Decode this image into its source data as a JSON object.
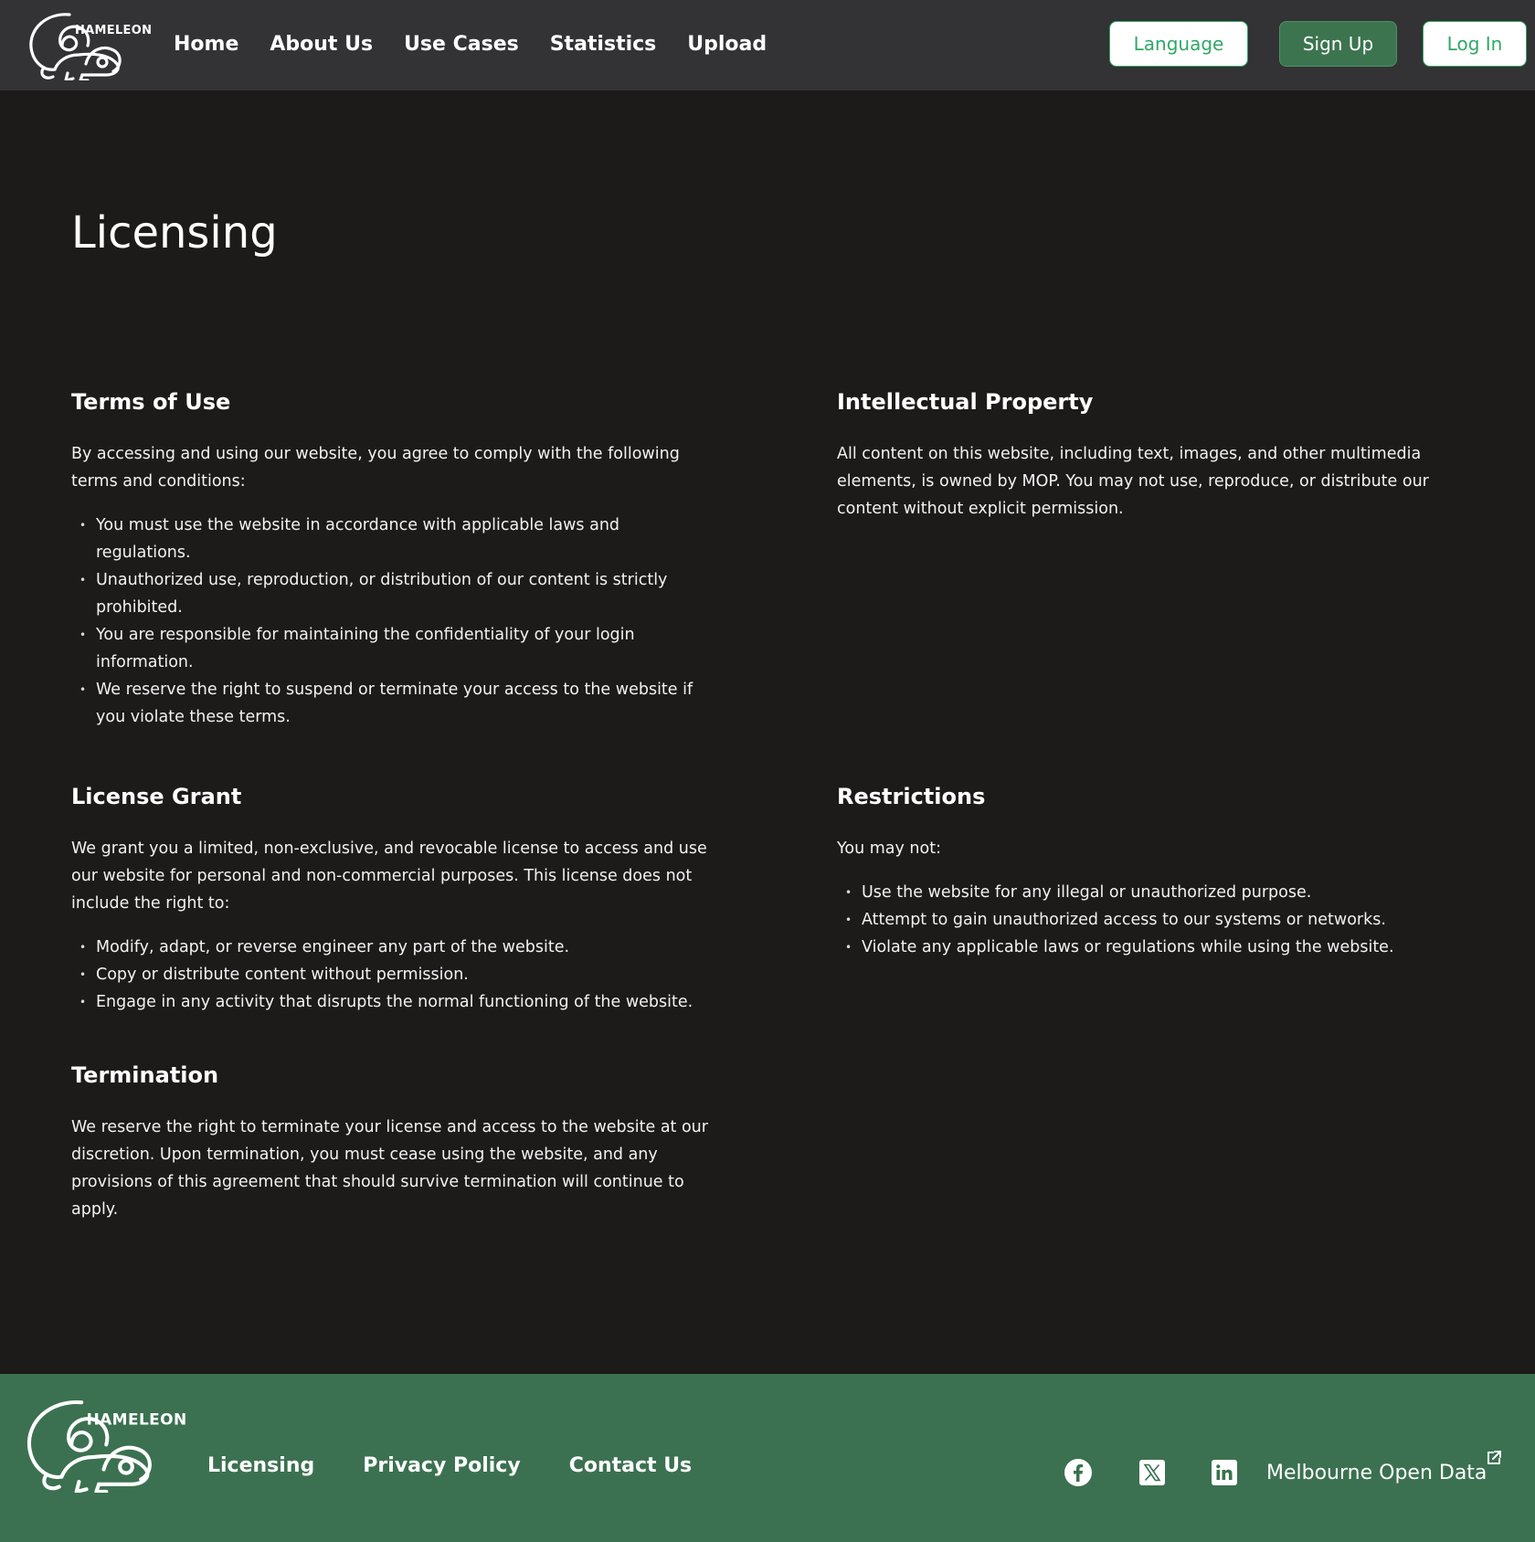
{
  "brand": {
    "name": "HAMELEON"
  },
  "header": {
    "nav": [
      "Home",
      "About Us",
      "Use Cases",
      "Statistics",
      "Upload"
    ],
    "language_label": "Language",
    "signup_label": "Sign Up",
    "login_label": "Log In"
  },
  "page": {
    "title": "Licensing",
    "sections": {
      "terms": {
        "heading": "Terms of Use",
        "intro": "By accessing and using our website, you agree to comply with the following terms and conditions:",
        "items": [
          "You must use the website in accordance with applicable laws and regulations.",
          "Unauthorized use, reproduction, or distribution of our content is strictly prohibited.",
          "You are responsible for maintaining the confidentiality of your login information.",
          "We reserve the right to suspend or terminate your access to the website if you violate these terms."
        ]
      },
      "ip": {
        "heading": "Intellectual Property",
        "body": "All content on this website, including text, images, and other multimedia elements, is owned by MOP. You may not use, reproduce, or distribute our content without explicit permission."
      },
      "grant": {
        "heading": "License Grant",
        "intro": "We grant you a limited, non-exclusive, and revocable license to access and use our website for personal and non-commercial purposes. This license does not include the right to:",
        "items": [
          "Modify, adapt, or reverse engineer any part of the website.",
          "Copy or distribute content without permission.",
          "Engage in any activity that disrupts the normal functioning of the website."
        ]
      },
      "restrictions": {
        "heading": "Restrictions",
        "intro": "You may not:",
        "items": [
          "Use the website for any illegal or unauthorized purpose.",
          "Attempt to gain unauthorized access to our systems or networks.",
          "Violate any applicable laws or regulations while using the website."
        ]
      },
      "termination": {
        "heading": "Termination",
        "body": "We reserve the right to terminate your license and access to the website at our discretion. Upon termination, you must cease using the website, and any provisions of this agreement that should survive termination will continue to apply."
      }
    }
  },
  "footer": {
    "links": [
      "Licensing",
      "Privacy Policy",
      "Contact Us"
    ],
    "social": [
      "facebook-icon",
      "x-icon",
      "linkedin-icon"
    ],
    "external_link": "Melbourne Open Data"
  },
  "colors": {
    "header_bg": "#333234",
    "page_bg": "#1d1a1a",
    "footer_bg": "#3b7150",
    "accent_green": "#2fa866",
    "button_green": "#3c7450"
  }
}
